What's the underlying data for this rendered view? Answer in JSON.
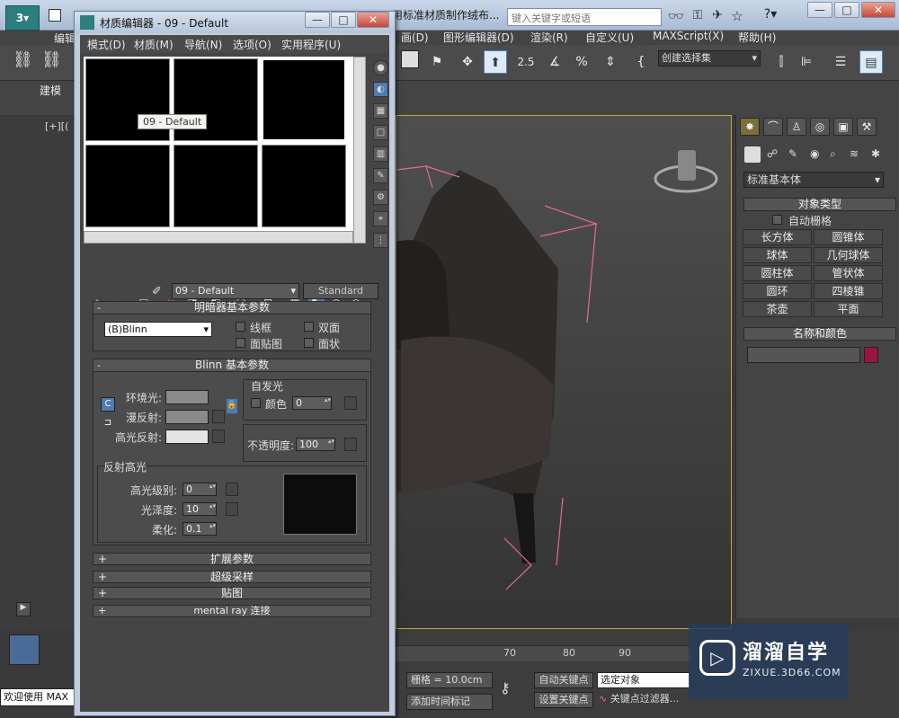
{
  "app": {
    "title_truncated": "用标准材质制作绒布...",
    "search_placeholder": "键入关键字或短语",
    "window_controls": [
      "—",
      "□",
      "✕"
    ]
  },
  "main_menu": [
    "画(D)",
    "图形编辑器(D)",
    "渲染(R)",
    "自定义(U)",
    "MAXScript(X)",
    "帮助(H)"
  ],
  "left_menu_fragment": "编辑",
  "toolbar": {
    "selection_set": "创建选择集",
    "angle_snap": "2.5"
  },
  "ribbon": {
    "tab": "建模"
  },
  "viewport": {
    "label": "[+][("
  },
  "command_panel": {
    "tabs": [
      "create",
      "modify",
      "hierarchy",
      "motion",
      "display",
      "utilities"
    ],
    "category": "标准基本体",
    "object_type_title": "对象类型",
    "autogrid": "自动栅格",
    "objects": [
      "长方体",
      "圆锥体",
      "球体",
      "几何球体",
      "圆柱体",
      "管状体",
      "圆环",
      "四棱锥",
      "茶壶",
      "平面"
    ],
    "name_color_title": "名称和颜色",
    "color_swatch": "#9b1442"
  },
  "material_editor": {
    "title": "材质编辑器 - 09 - Default",
    "menu": [
      "模式(D)",
      "材质(M)",
      "导航(N)",
      "选项(O)",
      "实用程序(U)"
    ],
    "tooltip": "09 - Default",
    "material_name": "09 - Default",
    "material_type": "Standard",
    "shader_rollout": {
      "title": "明暗器基本参数",
      "shader": "(B)Blinn",
      "options": [
        "线框",
        "双面",
        "面贴图",
        "面状"
      ]
    },
    "blinn_rollout": {
      "title": "Blinn 基本参数",
      "self_illum_title": "自发光",
      "color_label": "颜色",
      "self_illum_value": "0",
      "ambient_label": "环境光:",
      "diffuse_label": "漫反射:",
      "specular_label": "高光反射:",
      "opacity_label": "不透明度:",
      "opacity_value": "100",
      "specular_highlights_title": "反射高光",
      "specular_level_label": "高光级别:",
      "specular_level": "0",
      "glossiness_label": "光泽度:",
      "glossiness": "10",
      "soften_label": "柔化:",
      "soften": "0.1"
    },
    "collapsed_rollouts": [
      "扩展参数",
      "超级采样",
      "贴图",
      "mental ray 连接"
    ],
    "colors": {
      "ambient": "#8a8a8a",
      "diffuse": "#8a8a8a",
      "specular": "#e4e4e4"
    }
  },
  "status": {
    "welcome": "欢迎使用 MAX",
    "grid": "栅格 = 10.0cm",
    "auto_key": "自动关键点",
    "selected_object": "选定对象",
    "set_key": "设置关键点",
    "key_filters": "关键点过滤器...",
    "add_time_tag": "添加时间标记",
    "timeline_ticks": [
      "70",
      "80",
      "90"
    ]
  },
  "watermark": {
    "brand": "溜溜自学",
    "url": "ZIXUE.3D66.COM"
  }
}
